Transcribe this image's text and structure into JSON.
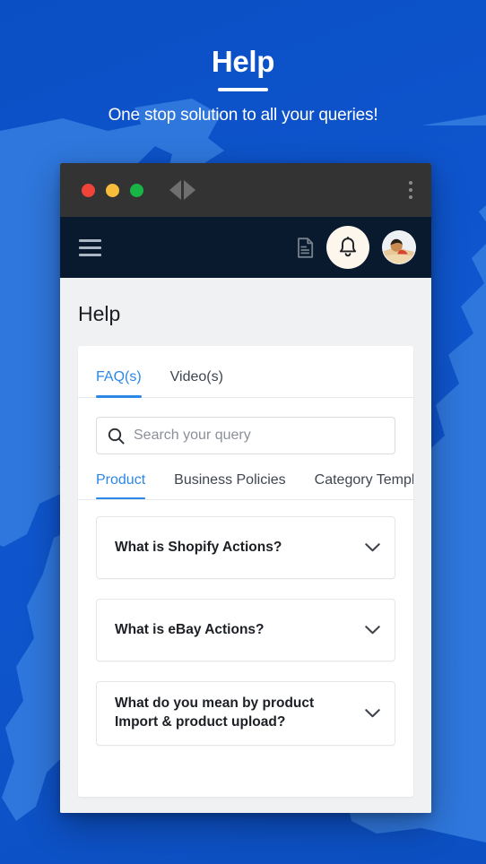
{
  "hero": {
    "title": "Help",
    "subtitle": "One stop solution to all your queries!"
  },
  "colors": {
    "background_blue": "#0d51c6",
    "map_blue": "#2f77dd",
    "titlebar": "#333333",
    "appbar": "#091a2e",
    "page_bg": "#f0f1f3",
    "accent_blue": "#2b87e8",
    "bell_circle": "#fdf6ec",
    "light_red": "#f04438",
    "light_amber": "#f6bd3b",
    "light_green": "#18b446"
  },
  "browser": {
    "traffic_lights": [
      "close-red",
      "minimize-amber",
      "maximize-green"
    ],
    "back_label": "Back",
    "forward_label": "Forward",
    "menu_label": "More options"
  },
  "appbar": {
    "menu_label": "Menu",
    "doc_label": "Documents",
    "notifications_label": "Notifications",
    "avatar_label": "Account"
  },
  "page": {
    "title": "Help",
    "tabs": [
      {
        "label": "FAQ(s)",
        "active": true
      },
      {
        "label": "Video(s)",
        "active": false
      }
    ],
    "search": {
      "placeholder": "Search your query",
      "value": ""
    },
    "category_tabs": [
      {
        "label": "Product",
        "active": true
      },
      {
        "label": "Business Policies",
        "active": false
      },
      {
        "label": "Category Template",
        "active": false
      }
    ],
    "faqs": [
      {
        "question": "What is Shopify Actions?",
        "expanded": false
      },
      {
        "question": "What is eBay Actions?",
        "expanded": false
      },
      {
        "question": "What do you mean by product Import & product upload?",
        "expanded": false
      }
    ]
  }
}
